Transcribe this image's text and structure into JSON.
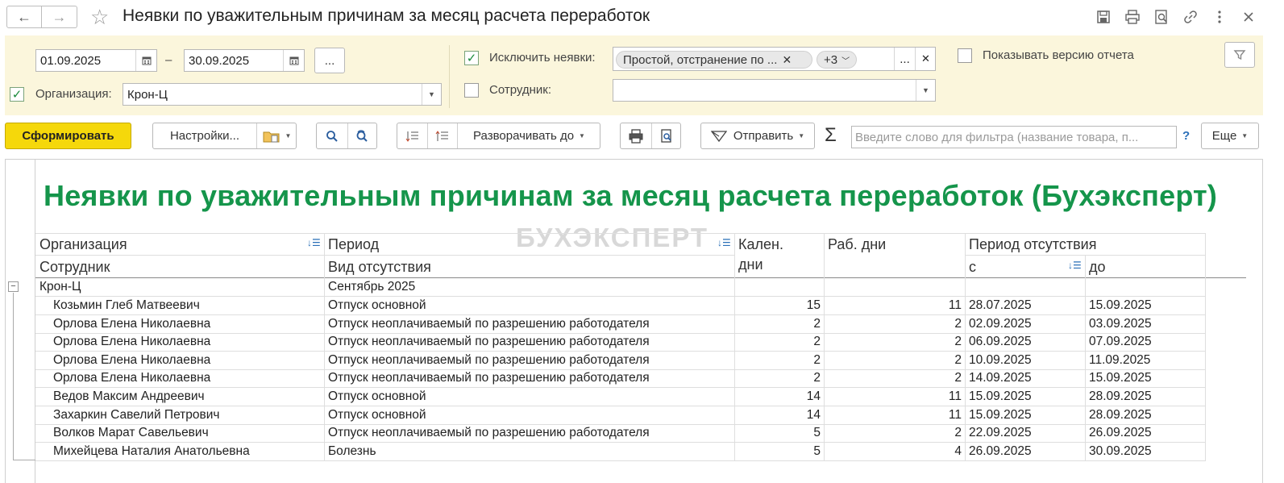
{
  "titlebar": {
    "title": "Неявки по уважительным причинам за месяц расчета переработок",
    "back_glyph": "←",
    "forward_glyph": "→",
    "star_glyph": "☆",
    "icons": [
      "save-icon",
      "print-icon",
      "preview-icon",
      "link-icon",
      "more-icon",
      "close-icon"
    ]
  },
  "filters": {
    "date_from": "01.09.2025",
    "date_sep": "–",
    "date_to": "30.09.2025",
    "dots_label": "...",
    "org_label": "Организация:",
    "org_value": "Крон-Ц",
    "exclude_label": "Исключить неявки:",
    "exclude_tag": "Простой, отстранение по ...",
    "exclude_more": "+3",
    "employee_label": "Сотрудник:",
    "employee_value": "",
    "show_version_label": "Показывать версию отчета"
  },
  "toolbar": {
    "generate": "Сформировать",
    "settings": "Настройки...",
    "expand_to": "Разворачивать до",
    "send": "Отправить",
    "sigma": "Σ",
    "search_placeholder": "Введите слово для фильтра (название товара, п...",
    "help": "?",
    "more": "Еще"
  },
  "report": {
    "title": "Неявки по уважительным причинам за месяц расчета переработок (Бухэксперт)",
    "watermark": "БУХЭКСПЕРТ",
    "headers": {
      "org": "Организация",
      "employee": "Сотрудник",
      "period": "Период",
      "absence_type": "Вид отсутствия",
      "cal_days_1": "Кален.",
      "cal_days_2": "дни",
      "work_days": "Раб. дни",
      "absence_period": "Период отсутствия",
      "from": "с",
      "to": "до"
    },
    "group": {
      "org": "Крон-Ц",
      "period": "Сентябрь 2025"
    },
    "rows": [
      [
        "Козьмин Глеб Матвеевич",
        "Отпуск основной",
        "15",
        "11",
        "28.07.2025",
        "15.09.2025"
      ],
      [
        "Орлова Елена Николаевна",
        "Отпуск неоплачиваемый по разрешению работодателя",
        "2",
        "2",
        "02.09.2025",
        "03.09.2025"
      ],
      [
        "Орлова Елена Николаевна",
        "Отпуск неоплачиваемый по разрешению работодателя",
        "2",
        "2",
        "06.09.2025",
        "07.09.2025"
      ],
      [
        "Орлова Елена Николаевна",
        "Отпуск неоплачиваемый по разрешению работодателя",
        "2",
        "2",
        "10.09.2025",
        "11.09.2025"
      ],
      [
        "Орлова Елена Николаевна",
        "Отпуск неоплачиваемый по разрешению работодателя",
        "2",
        "2",
        "14.09.2025",
        "15.09.2025"
      ],
      [
        "Ведов Максим Андреевич",
        "Отпуск основной",
        "14",
        "11",
        "15.09.2025",
        "28.09.2025"
      ],
      [
        "Захаркин Савелий Петрович",
        "Отпуск основной",
        "14",
        "11",
        "15.09.2025",
        "28.09.2025"
      ],
      [
        "Волков Марат Савельевич",
        "Отпуск неоплачиваемый по разрешению работодателя",
        "5",
        "2",
        "22.09.2025",
        "26.09.2025"
      ],
      [
        "Михейцева Наталия Анатольевна",
        "Болезнь",
        "5",
        "4",
        "26.09.2025",
        "30.09.2025"
      ]
    ]
  }
}
